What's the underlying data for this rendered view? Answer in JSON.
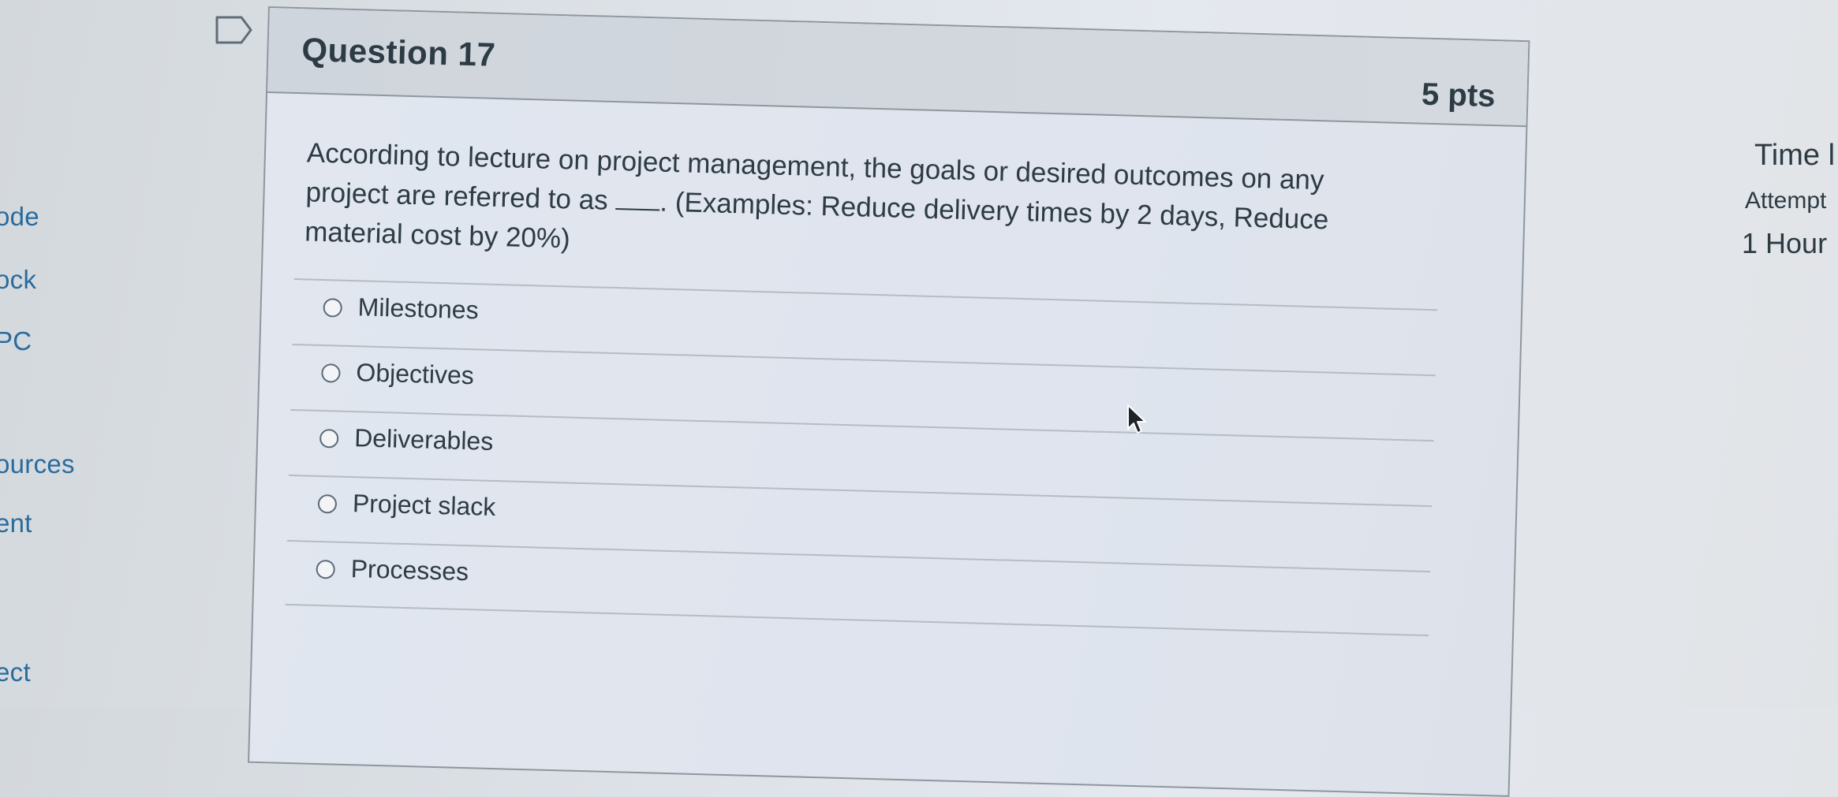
{
  "nav": {
    "items": [
      "ode",
      "ock",
      "PC",
      "ources",
      "ent",
      "ect"
    ]
  },
  "question": {
    "title": "Question 17",
    "points": "5 pts",
    "text_before_blank": "According to lecture on project management, the goals or desired outcomes on any project are referred to as ",
    "text_after_blank": ". (Examples: Reduce delivery times by 2 days, Reduce material cost by 20%)",
    "answers": [
      {
        "label": "Milestones"
      },
      {
        "label": "Objectives"
      },
      {
        "label": "Deliverables"
      },
      {
        "label": "Project slack"
      },
      {
        "label": "Processes"
      }
    ]
  },
  "timer_panel": {
    "time_label": "Time l",
    "attempt_label": "Attempt",
    "hours_value": "1 Hour"
  },
  "icons": {
    "flag": "bookmark-flag-icon",
    "cursor": "mouse-pointer-icon",
    "radio": "radio-unselected-icon"
  },
  "colors": {
    "text": "#2d3b45",
    "nav_link": "#2a6b9c",
    "border": "#8e979e",
    "header_bg": "#cfd5dc"
  }
}
